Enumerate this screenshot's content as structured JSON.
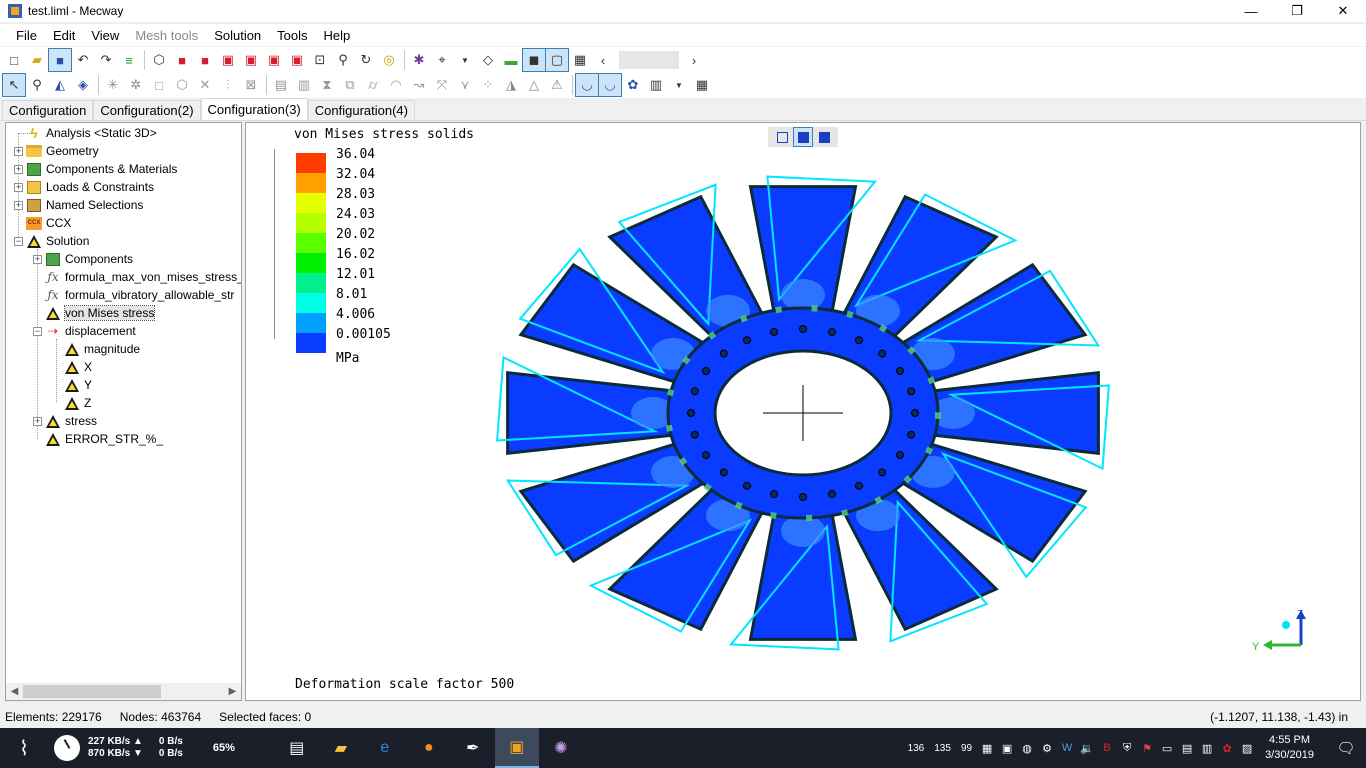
{
  "window": {
    "title": "test.liml - Mecway",
    "minimize": "—",
    "restore": "❐",
    "close": "✕"
  },
  "menu": [
    {
      "label": "File",
      "disabled": false
    },
    {
      "label": "Edit",
      "disabled": false
    },
    {
      "label": "View",
      "disabled": false
    },
    {
      "label": "Mesh tools",
      "disabled": true
    },
    {
      "label": "Solution",
      "disabled": false
    },
    {
      "label": "Tools",
      "disabled": false
    },
    {
      "label": "Help",
      "disabled": false
    }
  ],
  "tabs": [
    "Configuration",
    "Configuration(2)",
    "Configuration(3)",
    "Configuration(4)"
  ],
  "active_tab": "Configuration(3)",
  "tree": {
    "analysis": "Analysis <Static 3D>",
    "geometry": "Geometry",
    "components_materials": "Components & Materials",
    "loads_constraints": "Loads & Constraints",
    "named_selections": "Named Selections",
    "ccx": "CCX",
    "ccx_icon_text": "CCX",
    "solution": "Solution",
    "components": "Components",
    "formula_1": "formula_max_von_mises_stress_",
    "formula_2": "formula_vibratory_allowable_str",
    "von_mises": "von Mises stress",
    "displacement": "displacement",
    "magnitude": "magnitude",
    "x": "X",
    "y": "Y",
    "z": "Z",
    "stress": "stress",
    "error": "ERROR_STR_%_"
  },
  "viewport": {
    "title": "von Mises stress solids",
    "unit": "MPa",
    "footer": "Deformation scale factor 500",
    "legend": [
      {
        "value": "36.04",
        "color": "#ff3c00"
      },
      {
        "value": "32.04",
        "color": "#ffa000"
      },
      {
        "value": "28.03",
        "color": "#e6ff00"
      },
      {
        "value": "24.03",
        "color": "#b4ff00"
      },
      {
        "value": "20.02",
        "color": "#5aff00"
      },
      {
        "value": "16.02",
        "color": "#00f000"
      },
      {
        "value": "12.01",
        "color": "#00f08c"
      },
      {
        "value": "8.01",
        "color": "#00ffe6"
      },
      {
        "value": "4.006",
        "color": "#00a0ff"
      },
      {
        "value": "0.00105",
        "color": "#0a3cff"
      }
    ],
    "axis_y": "Y",
    "axis_z": "Z"
  },
  "status": {
    "elements": "Elements: 229176",
    "nodes": "Nodes: 463764",
    "selected": "Selected faces: 0",
    "coords": "(-1.1207, 11.138, -1.43) in"
  },
  "taskbar": {
    "net_up": "227 KB/s ▲",
    "net_down": "870 KB/s ▼",
    "disk_up": "0 B/s",
    "disk_down": "0 B/s",
    "cpu": "65%",
    "tray_nums": [
      "136",
      "135",
      "99"
    ],
    "time": "4:55 PM",
    "date": "3/30/2019"
  }
}
